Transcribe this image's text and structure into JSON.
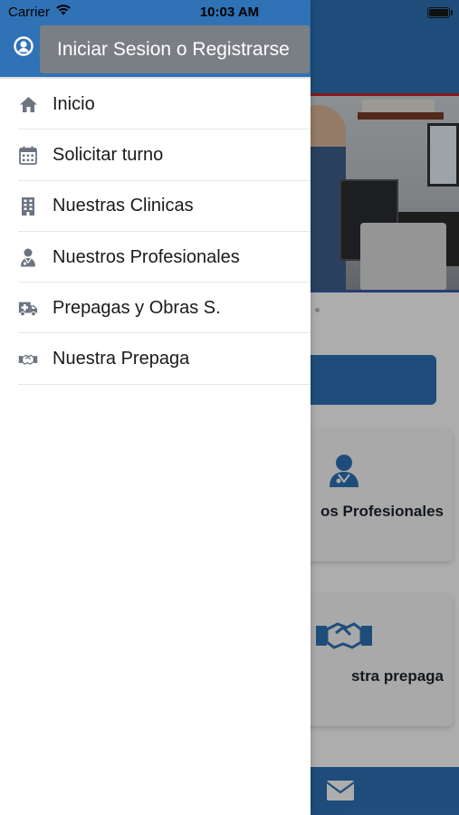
{
  "status_bar": {
    "carrier": "Carrier",
    "time": "10:03 AM",
    "wifi_icon": "wifi-icon",
    "battery_icon": "battery-icon"
  },
  "drawer": {
    "header": {
      "user_icon": "user-circle-icon",
      "login_label": "Iniciar Sesion o Registrarse"
    },
    "items": [
      {
        "label": "Inicio",
        "icon": "home-icon"
      },
      {
        "label": "Solicitar turno",
        "icon": "calendar-icon"
      },
      {
        "label": "Nuestras Clinicas",
        "icon": "building-icon"
      },
      {
        "label": "Nuestros Profesionales",
        "icon": "doctor-icon"
      },
      {
        "label": "Prepagas y Obras S.",
        "icon": "ambulance-icon"
      },
      {
        "label": "Nuestra Prepaga",
        "icon": "handshake-icon"
      }
    ]
  },
  "background": {
    "card1_label": "os Profesionales",
    "card2_label": "stra prepaga",
    "footer_icon": "mail-icon"
  },
  "colors": {
    "primary": "#2f72b6",
    "login_button": "#7a7f85",
    "icon_gray": "#6b7480"
  }
}
